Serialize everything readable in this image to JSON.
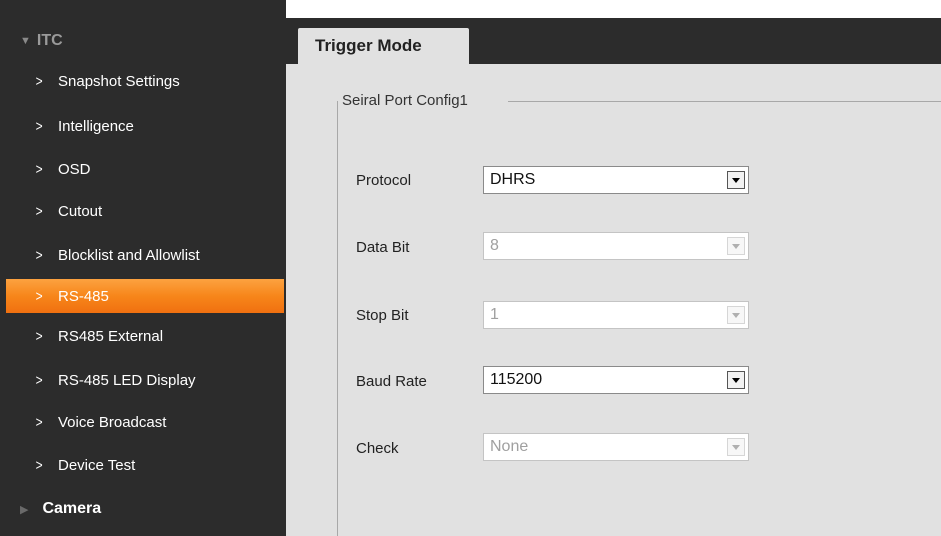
{
  "sidebar": {
    "group_itc": "ITC",
    "items": [
      {
        "label": "Snapshot Settings"
      },
      {
        "label": "Intelligence"
      },
      {
        "label": "OSD"
      },
      {
        "label": "Cutout"
      },
      {
        "label": "Blocklist and Allowlist"
      },
      {
        "label": "RS-485",
        "active": true
      },
      {
        "label": "RS485 External"
      },
      {
        "label": "RS-485 LED Display"
      },
      {
        "label": "Voice Broadcast"
      },
      {
        "label": "Device Test"
      }
    ],
    "group_camera": "Camera"
  },
  "main": {
    "tab": "Trigger Mode",
    "fieldset_legend": "Seiral Port Config1",
    "fields": {
      "protocol": {
        "label": "Protocol",
        "value": "DHRS",
        "enabled": true
      },
      "data_bit": {
        "label": "Data Bit",
        "value": "8",
        "enabled": false
      },
      "stop_bit": {
        "label": "Stop Bit",
        "value": "1",
        "enabled": false
      },
      "baud_rate": {
        "label": "Baud Rate",
        "value": "115200",
        "enabled": true
      },
      "check": {
        "label": "Check",
        "value": "None",
        "enabled": false
      }
    }
  },
  "colors": {
    "sidebar_bg": "#2c2c2c",
    "active_accent": "#f7861a",
    "content_bg": "#e1e1e1"
  }
}
